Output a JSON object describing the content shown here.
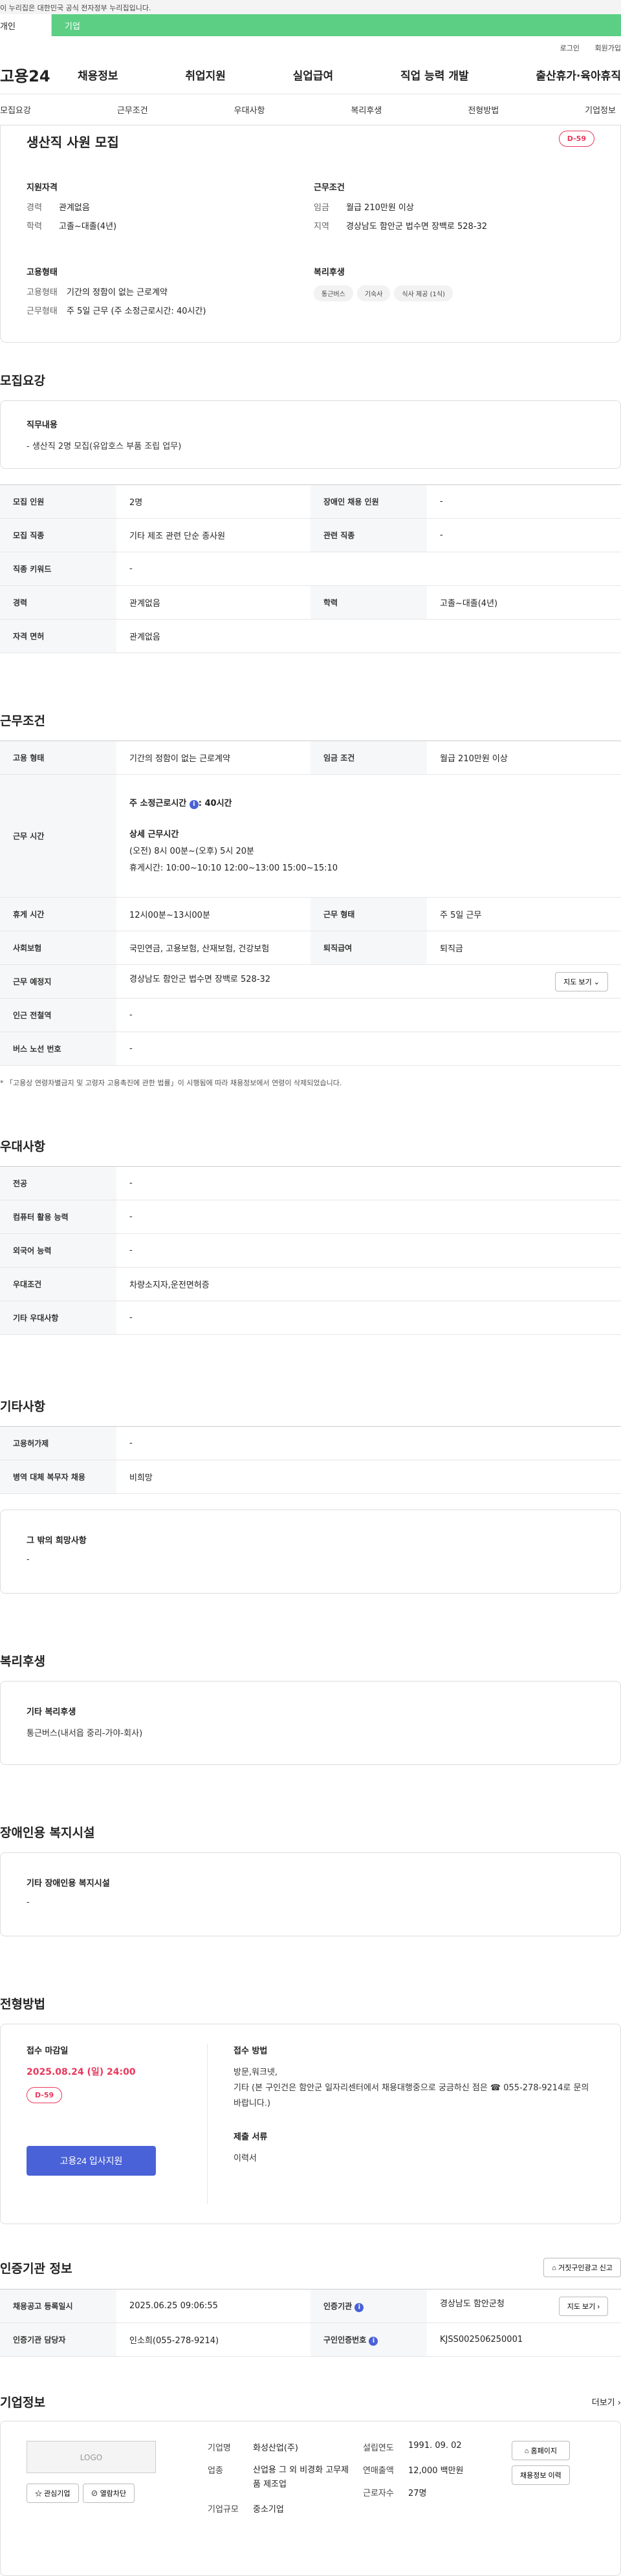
{
  "notice": "이 누리집은 대한민국 공식 전자정부 누리집입니다.",
  "topbar": {
    "individual": "개인",
    "corporate": "기업"
  },
  "util": {
    "login": "로그인",
    "signup": "회원가입"
  },
  "gnb": {
    "logo": "고용24",
    "menu": [
      "채용정보",
      "취업지원",
      "실업급여",
      "직업 능력 개발",
      "출산휴가·육아휴직"
    ]
  },
  "subnav": [
    "모집요강",
    "근무조건",
    "우대사항",
    "복리후생",
    "전형방법",
    "기업정보"
  ],
  "summary": {
    "title": "생산직 사원 모집",
    "dday": "D-59",
    "qual_h": "지원자격",
    "career_k": "경력",
    "career_v": "관계없음",
    "edu_k": "학력",
    "edu_v": "고졸~대졸(4년)",
    "cond_h": "근무조건",
    "wage_k": "임금",
    "wage_v": "월급 210만원 이상",
    "region_k": "지역",
    "region_v": "경상남도 함안군 법수면 장백로 528-32",
    "emp_h": "고용형태",
    "emptype_k": "고용형태",
    "emptype_v": "기간의 정함이 없는 근로계약",
    "worktype_k": "근무형태",
    "worktype_v": "주 5일 근무 (주 소정근로시간: 40시간)",
    "welfare_h": "복리후생",
    "chips": [
      "통근버스",
      "기숙사",
      "식사 제공 (1식)"
    ]
  },
  "recruit": {
    "title": "모집요강",
    "duty_h": "직무내용",
    "duty_v": "- 생산직 2명 모집(유압호스 부품 조립 업무)",
    "rows": {
      "r1": [
        "모집 인원",
        "2명",
        "장애인 채용 인원",
        "-"
      ],
      "r2": [
        "모집 직종",
        "기타 제조 관련 단순 종사원",
        "관련 직종",
        "-"
      ],
      "r3": [
        "직종 키워드",
        "-"
      ],
      "r4": [
        "경력",
        "관계없음",
        "학력",
        "고졸~대졸(4년)"
      ],
      "r5": [
        "자격 면허",
        "관계없음"
      ]
    }
  },
  "workcond": {
    "title": "근무조건",
    "emptype": [
      "고용 형태",
      "기간의 정함이 없는 근로계약",
      "임금 조건",
      "월급 210만원 이상"
    ],
    "hours_k": "근무 시간",
    "hours_main": "주 소정근로시간",
    "hours_main_v": ": 40시간",
    "hours_detail_h": "상세 근무시간",
    "hours_detail": "(오전) 8시 00분~(오후) 5시 20분",
    "hours_break": "휴게시간: 10:00~10:10 12:00~13:00 15:00~15:10",
    "rest": [
      "휴게 시간",
      "12시00분~13시00분",
      "근무 형태",
      "주 5일 근무"
    ],
    "insurance": [
      "사회보험",
      "국민연금, 고용보험, 산재보험, 건강보험",
      "퇴직급여",
      "퇴직금"
    ],
    "location": [
      "근무 예정지",
      "경상남도 함안군 법수면 장백로 528-32"
    ],
    "map_btn": "지도 보기",
    "subway": [
      "인근 전철역",
      "-"
    ],
    "bus": [
      "버스 노선 번호",
      "-"
    ],
    "note": "* 「고용상 연령차별금지 및 고령자 고용촉진에 관한 법률」이 시행됨에 따라 채용정보에서 연령이 삭제되었습니다."
  },
  "pref": {
    "title": "우대사항",
    "rows": [
      [
        "전공",
        "-"
      ],
      [
        "컴퓨터 활용 능력",
        "-"
      ],
      [
        "외국어 능력",
        "-"
      ],
      [
        "우대조건",
        "차량소지자,운전면허증"
      ],
      [
        "기타 우대사항",
        "-"
      ]
    ]
  },
  "etc": {
    "title": "기타사항",
    "rows": [
      [
        "고용허가제",
        "-"
      ],
      [
        "병역 대체 복무자 채용",
        "비희망"
      ]
    ],
    "hope_h": "그 밖의 희망사항",
    "hope_v": "-"
  },
  "welfare": {
    "title": "복리후생",
    "h": "기타 복리후생",
    "v": "통근버스(내서읍 중리-가야-회사)"
  },
  "disabled": {
    "title": "장애인용 복지시설",
    "h": "기타 장애인용 복지시설",
    "v": "-"
  },
  "method": {
    "title": "전형방법",
    "deadline_h": "접수 마감일",
    "deadline": "2025.08.24 (일) 24:00",
    "dday": "D-59",
    "apply_btn": "고용24 입사지원",
    "way_h": "접수 방법",
    "way_v1": "방문,워크넷,",
    "way_v2": "기타 (본 구인건은 함안군 일자리센터에서 채용대행중으로 궁금하신 점은 ☎ 055-278-9214로 문의 바랍니다.)",
    "docs_h": "제출 서류",
    "docs_v": "이력서"
  },
  "cert": {
    "title": "인증기관 정보",
    "report_btn": "거짓구인광고 신고",
    "r1": [
      "채용공고 등록일시",
      "2025.06.25 09:06:55",
      "인증기관",
      "경상남도 함안군청"
    ],
    "map_btn": "지도 보기",
    "r2": [
      "인증기관 담당자",
      "인소희(055-278-9214)",
      "구인인증번호",
      "KJSS002506250001"
    ]
  },
  "companyinfo": {
    "title": "기업정보",
    "more": "더보기",
    "logo": "LOGO",
    "fav_btn": "관심기업",
    "block_btn": "열람차단",
    "name_k": "기업명",
    "name_v": "화성산업(주)",
    "ind_k": "업종",
    "ind_v": "산업용 그 외 비경화 고무제품 제조업",
    "size_k": "기업규모",
    "size_v": "중소기업",
    "est_k": "설립연도",
    "est_v": "1991. 09. 02",
    "sales_k": "연매출액",
    "sales_v": "12,000 백만원",
    "emp_k": "근로자수",
    "emp_v": "27명",
    "home_btn": "홈페이지",
    "history_btn": "채용정보 이력"
  }
}
